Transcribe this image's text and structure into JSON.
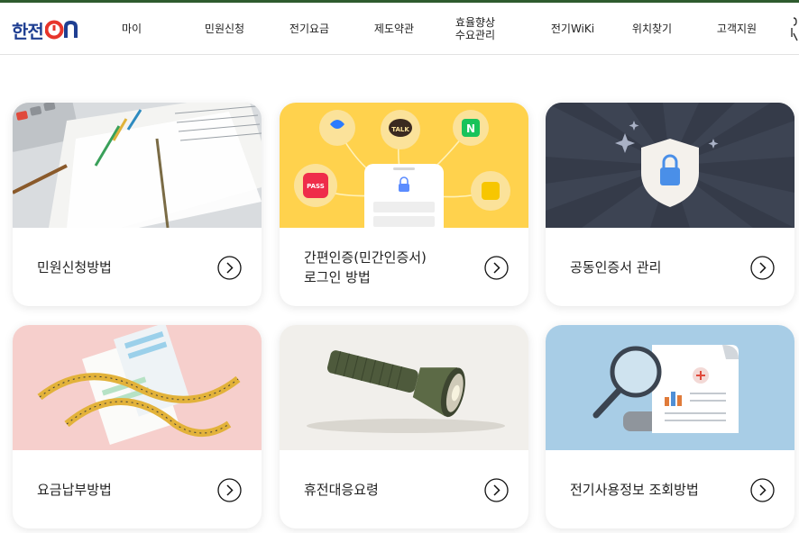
{
  "header": {
    "logo": {
      "brand_text": "한전",
      "on_text": "ON"
    },
    "nav": [
      {
        "label": "마이"
      },
      {
        "label": "민원신청"
      },
      {
        "label": "전기요금"
      },
      {
        "label": "제도약관"
      },
      {
        "label": "효율향상\n수요관리"
      },
      {
        "label": "전기WiKi"
      },
      {
        "label": "위치찾기"
      },
      {
        "label": "고객지원"
      }
    ]
  },
  "cards": [
    {
      "title": "민원신청방법",
      "image_icon": "documents-photo-icon"
    },
    {
      "title": "간편인증(민간인증서)\n로그인 방법",
      "image_icon": "simple-auth-illustration-icon",
      "app_badges": [
        "TALK",
        "N",
        "PASS"
      ]
    },
    {
      "title": "공동인증서 관리",
      "image_icon": "shield-lock-icon"
    },
    {
      "title": "요금납부방법",
      "image_icon": "receipts-photo-icon"
    },
    {
      "title": "휴전대응요령",
      "image_icon": "flashlight-photo-icon"
    },
    {
      "title": "전기사용정보 조회방법",
      "image_icon": "magnifier-report-icon"
    }
  ],
  "colors": {
    "brand_navy": "#1f3f92",
    "brand_red": "#e7352b",
    "topline_green": "#2e5b2e",
    "card2_bg": "#ffd24d",
    "card3_bg": "#3d4453",
    "card4_bg": "#f6cfcc",
    "card5_bg": "#f1efeb",
    "card6_bg": "#a8cde6"
  }
}
